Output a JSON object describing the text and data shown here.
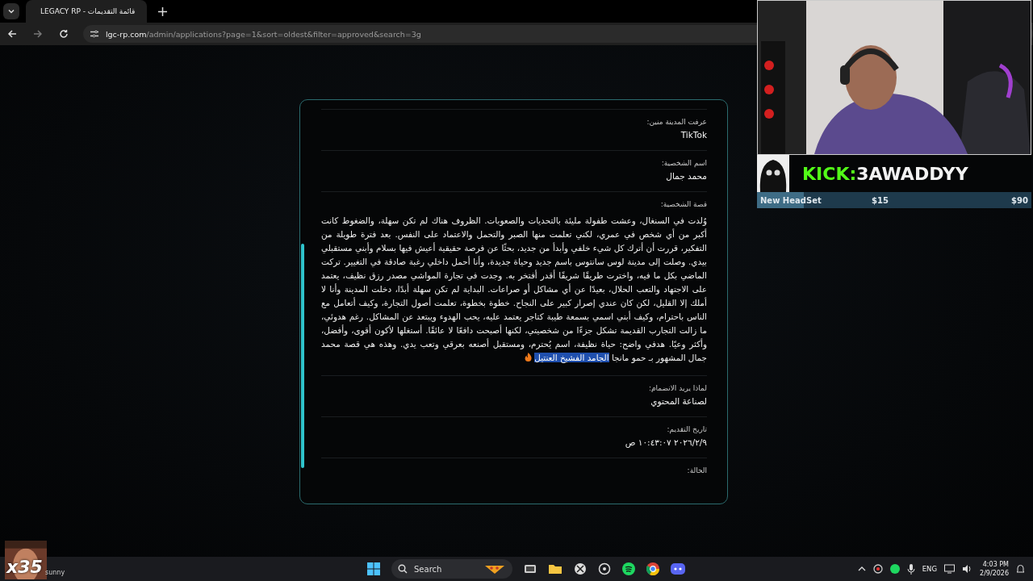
{
  "browser": {
    "tab_title": "LEGACY RP - قائمة التقديمات",
    "url_domain": "lgc-rp.com",
    "url_path": "/admin/applications?page=1&sort=oldest&filter=approved&search=3g"
  },
  "application": {
    "fields": [
      {
        "kind": "text",
        "label": "عرفت المدينة منين:",
        "value": "TikTok"
      },
      {
        "kind": "text",
        "label": "اسم الشخصية:",
        "value": "محمد جمال"
      },
      {
        "kind": "story",
        "label": "قصة الشخصية:",
        "value": "وُلدت في السنغال، وعشت طفولة مليئة بالتحديات والصعوبات. الظروف هناك لم تكن سهلة، والضغوط كانت أكبر من أي شخص في عمري، لكني تعلمت منها الصبر والتحمل والاعتماد على النفس. بعد فترة طويلة من التفكير، قررت أن أترك كل شيء خلفي وأبدأ من جديد، بحثًا عن فرصة حقيقية أعيش فيها بسلام وأبني مستقبلي بيدي. وصلت إلى مدينة لوس سانتوس باسم جديد وحياة جديدة، وأنا أحمل داخلي رغبة صادقة في التغيير. تركت الماضي بكل ما فيه، واخترت طريقًا شريفًا أقدر أفتخر به. وجدت في تجارة المواشي مصدر رزق نظيف، يعتمد على الاجتهاد والتعب الحلال، بعيدًا عن أي مشاكل أو صراعات. البداية لم تكن سهلة أبدًا، دخلت المدينة وأنا لا أملك إلا القليل، لكن كان عندي إصرار كبير على النجاح. خطوة بخطوة، تعلمت أصول التجارة، وكيف أتعامل مع الناس باحترام، وكيف أبني اسمي بسمعة طيبة كتاجر يعتمد عليه، يحب الهدوء ويبتعد عن المشاكل. رغم هدوئي، ما زالت التجارب القديمة تشكل جزءًا من شخصيتي، لكنها أصبحت دافعًا لا عائقًا. أستغلها لأكون أقوى، وأفضل، وأكثر وعيًا. هدفي واضح: حياة نظيفة، اسم يُحترم، ومستقبل أصنعه بعرقي وتعب يدي. وهذه هي قصة محمد جمال المشهور بـ حمو مانجا",
        "selected_text": "الجامد الفشيخ العنتيل"
      },
      {
        "kind": "text",
        "label": "لماذا يريد الانضمام:",
        "value": "لصناعة المحتوي"
      },
      {
        "kind": "text",
        "label": "تاريخ التقديم:",
        "value": "٢٠٢٦/٢/٩ ١٠:٤٣:٠٧ ص"
      },
      {
        "kind": "text",
        "label": "الحالة:"
      }
    ]
  },
  "stream_overlay": {
    "channel_prefix": "KICK:",
    "channel_name": "3AWADDYY",
    "goal": {
      "label": "New HeadSet",
      "current": "$15",
      "target": "$90",
      "level": 0.17
    },
    "emote_count": "x35"
  },
  "taskbar": {
    "search_placeholder": "Search",
    "weather": "sunny",
    "language": "ENG",
    "time": "4:03 PM",
    "date": "2/9/2026"
  }
}
